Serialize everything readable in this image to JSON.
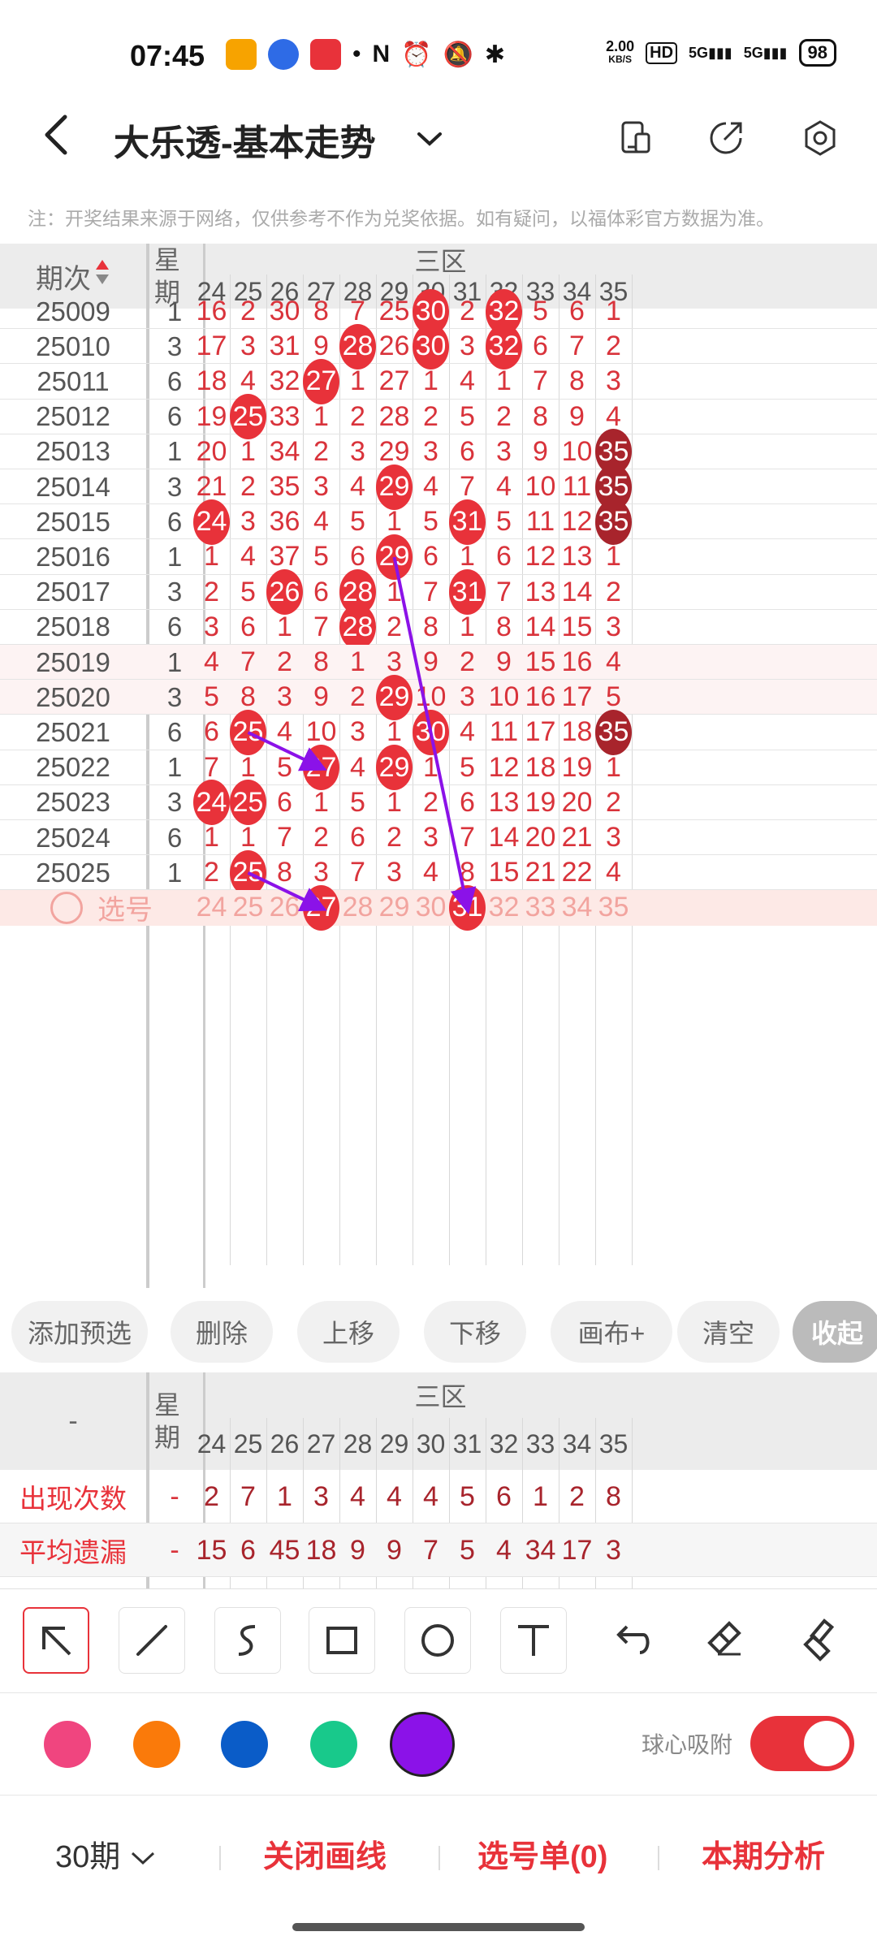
{
  "status_bar": {
    "time": "07:45",
    "net_speed": "2.00",
    "net_speed_unit": "KB/S",
    "hd_label": "HD",
    "signal_1": "5G",
    "signal_2": "5G",
    "battery": "98",
    "icons": [
      "app-icon-orange",
      "app-icon-baidu",
      "app-icon-red",
      "dot-icon",
      "nfc-icon",
      "alarm-icon",
      "mute-icon",
      "bluetooth-icon"
    ]
  },
  "header": {
    "back_icon": "chevron-left",
    "title": "大乐透-基本走势",
    "dropdown_icon": "chevron-down",
    "actions": [
      "device-icon",
      "share-icon",
      "settings-icon"
    ]
  },
  "notice": "注：开奖结果来源于网络，仅供参考不作为兑奖依据。如有疑问，以福体彩官方数据为准。",
  "trend_table": {
    "col_period_label": "期次",
    "col_week_label": "星期",
    "zone_label": "三区",
    "number_columns": [
      "24",
      "25",
      "26",
      "27",
      "28",
      "29",
      "30",
      "31",
      "32",
      "33",
      "34",
      "35"
    ],
    "rows": [
      {
        "period": "25009",
        "week": "1",
        "cells": [
          "16",
          "2",
          "30",
          "8",
          "7",
          "25",
          "30",
          "2",
          "32",
          "5",
          "6",
          "1"
        ],
        "hits": [
          6,
          8
        ]
      },
      {
        "period": "25010",
        "week": "3",
        "cells": [
          "17",
          "3",
          "31",
          "9",
          "28",
          "26",
          "30",
          "3",
          "32",
          "6",
          "7",
          "2"
        ],
        "hits": [
          4,
          6,
          8
        ]
      },
      {
        "period": "25011",
        "week": "6",
        "cells": [
          "18",
          "4",
          "32",
          "27",
          "1",
          "27",
          "1",
          "4",
          "1",
          "7",
          "8",
          "3"
        ],
        "hits": [
          3
        ]
      },
      {
        "period": "25012",
        "week": "6",
        "cells": [
          "19",
          "25",
          "33",
          "1",
          "2",
          "28",
          "2",
          "5",
          "2",
          "8",
          "9",
          "4"
        ],
        "hits": [
          1
        ]
      },
      {
        "period": "25013",
        "week": "1",
        "cells": [
          "20",
          "1",
          "34",
          "2",
          "3",
          "29",
          "3",
          "6",
          "3",
          "9",
          "10",
          "35"
        ],
        "hits": [
          11
        ]
      },
      {
        "period": "25014",
        "week": "3",
        "cells": [
          "21",
          "2",
          "35",
          "3",
          "4",
          "29",
          "4",
          "7",
          "4",
          "10",
          "11",
          "35"
        ],
        "hits": [
          5,
          11
        ]
      },
      {
        "period": "25015",
        "week": "6",
        "cells": [
          "24",
          "3",
          "36",
          "4",
          "5",
          "1",
          "5",
          "31",
          "5",
          "11",
          "12",
          "35"
        ],
        "hits": [
          0,
          7,
          11
        ]
      },
      {
        "period": "25016",
        "week": "1",
        "cells": [
          "1",
          "4",
          "37",
          "5",
          "6",
          "29",
          "6",
          "1",
          "6",
          "12",
          "13",
          "1"
        ],
        "hits": [
          5
        ]
      },
      {
        "period": "25017",
        "week": "3",
        "cells": [
          "2",
          "5",
          "26",
          "6",
          "28",
          "1",
          "7",
          "31",
          "7",
          "13",
          "14",
          "2"
        ],
        "hits": [
          2,
          4,
          7
        ]
      },
      {
        "period": "25018",
        "week": "6",
        "cells": [
          "3",
          "6",
          "1",
          "7",
          "28",
          "2",
          "8",
          "1",
          "8",
          "14",
          "15",
          "3"
        ],
        "hits": [
          4
        ]
      },
      {
        "period": "25019",
        "week": "1",
        "cells": [
          "4",
          "7",
          "2",
          "8",
          "1",
          "3",
          "9",
          "2",
          "9",
          "15",
          "16",
          "4"
        ],
        "hits": []
      },
      {
        "period": "25020",
        "week": "3",
        "cells": [
          "5",
          "8",
          "3",
          "9",
          "2",
          "29",
          "10",
          "3",
          "10",
          "16",
          "17",
          "5"
        ],
        "hits": [
          5
        ]
      },
      {
        "period": "25021",
        "week": "6",
        "cells": [
          "6",
          "25",
          "4",
          "10",
          "3",
          "1",
          "30",
          "4",
          "11",
          "17",
          "18",
          "35"
        ],
        "hits": [
          1,
          6,
          11
        ]
      },
      {
        "period": "25022",
        "week": "1",
        "cells": [
          "7",
          "1",
          "5",
          "27",
          "4",
          "29",
          "1",
          "5",
          "12",
          "18",
          "19",
          "1"
        ],
        "hits": [
          3,
          5
        ]
      },
      {
        "period": "25023",
        "week": "3",
        "cells": [
          "24",
          "25",
          "6",
          "1",
          "5",
          "1",
          "2",
          "6",
          "13",
          "19",
          "20",
          "2"
        ],
        "hits": [
          0,
          1
        ]
      },
      {
        "period": "25024",
        "week": "6",
        "cells": [
          "1",
          "1",
          "7",
          "2",
          "6",
          "2",
          "3",
          "7",
          "14",
          "20",
          "21",
          "3"
        ],
        "hits": []
      },
      {
        "period": "25025",
        "week": "1",
        "cells": [
          "2",
          "25",
          "8",
          "3",
          "7",
          "3",
          "4",
          "8",
          "15",
          "21",
          "22",
          "4"
        ],
        "hits": [
          1
        ]
      }
    ],
    "select_row": {
      "label": "选号",
      "cells": [
        "24",
        "25",
        "26",
        "27",
        "28",
        "29",
        "30",
        "31",
        "32",
        "33",
        "34",
        "35"
      ],
      "selected": [
        3,
        7
      ]
    }
  },
  "actions_row": [
    "添加预选",
    "删除",
    "上移",
    "下移",
    "画布+",
    "清空",
    "收起"
  ],
  "stats_table": {
    "col_first_label": "-",
    "col_week_label": "星期",
    "zone_label": "三区",
    "number_columns": [
      "24",
      "25",
      "26",
      "27",
      "28",
      "29",
      "30",
      "31",
      "32",
      "33",
      "34",
      "35"
    ],
    "rows": [
      {
        "label": "出现次数",
        "week": "-",
        "cells": [
          "2",
          "7",
          "1",
          "3",
          "4",
          "4",
          "4",
          "5",
          "6",
          "1",
          "2",
          "8"
        ]
      },
      {
        "label": "平均遗漏",
        "week": "-",
        "cells": [
          "15",
          "6",
          "45",
          "18",
          "9",
          "9",
          "7",
          "5",
          "4",
          "34",
          "17",
          "3"
        ]
      }
    ]
  },
  "drawing_tools": [
    "arrow-select-icon",
    "line-icon",
    "curve-icon",
    "rectangle-icon",
    "circle-icon",
    "text-icon",
    "undo-icon",
    "eraser-icon",
    "clear-brush-icon"
  ],
  "colors": {
    "swatches": [
      "#F0457F",
      "#FA7A0A",
      "#0A5CC8",
      "#18C98B",
      "#8B12E8"
    ],
    "selected_swatch": 4,
    "accent_red": "#E8323A",
    "dark_red": "#A8242C",
    "purple_line": "#8B12E8",
    "period_text": "#555555",
    "cell_text": "#D9333B"
  },
  "snap": {
    "label": "球心吸附",
    "on": true
  },
  "bottom_bar": {
    "period_select": "30期",
    "close_drawing": "关闭画线",
    "selection_list": "选号单(0)",
    "period_analysis": "本期分析"
  }
}
